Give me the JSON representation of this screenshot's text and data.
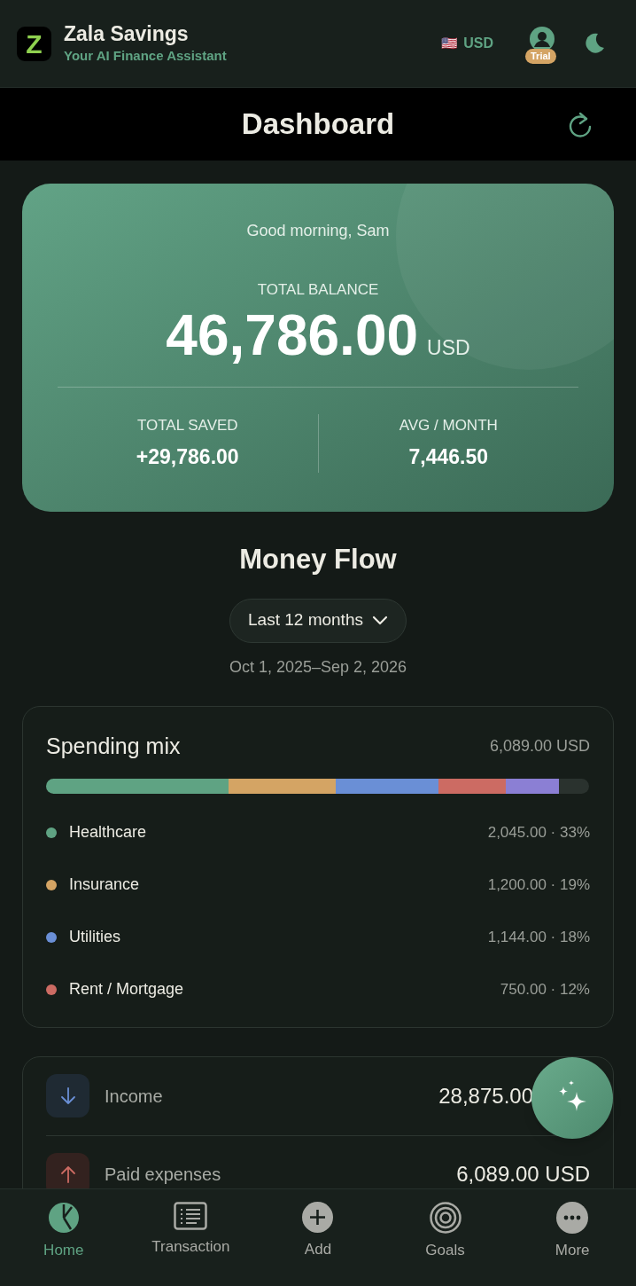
{
  "app": {
    "logo": "Z",
    "name": "Zala Savings",
    "tagline": "Your AI Finance Assistant",
    "currency": "USD",
    "flag": "🇺🇸",
    "badge": "Trial"
  },
  "page_title": "Dashboard",
  "balance_card": {
    "greeting": "Good morning, Sam",
    "label": "TOTAL BALANCE",
    "amount": "46,786.00",
    "currency": "USD",
    "stats": [
      {
        "label": "TOTAL SAVED",
        "value": "+29,786.00"
      },
      {
        "label": "AVG / MONTH",
        "value": "7,446.50"
      }
    ]
  },
  "money_flow": {
    "title": "Money Flow",
    "period": "Last 12 months",
    "range": "Oct 1, 2025–Sep 2, 2026"
  },
  "spending_mix": {
    "title": "Spending mix",
    "total": "6,089.00 USD",
    "bar_segments": [
      {
        "color": "#5fa383"
      },
      {
        "color": "#d4a464"
      },
      {
        "color": "#6a8fd6"
      },
      {
        "color": "#cc6b63"
      },
      {
        "color": "#8b7fd4"
      }
    ],
    "items": [
      {
        "name": "Healthcare",
        "color": "#5fa383",
        "value": "2,045.00 · 33%"
      },
      {
        "name": "Insurance",
        "color": "#d4a464",
        "value": "1,200.00 · 19%"
      },
      {
        "name": "Utilities",
        "color": "#6a8fd6",
        "value": "1,144.00 · 18%"
      },
      {
        "name": "Rent / Mortgage",
        "color": "#cc6b63",
        "value": "750.00 · 12%"
      }
    ]
  },
  "flow_rows": [
    {
      "kind": "income",
      "label": "Income",
      "amount": "28,875.00"
    },
    {
      "kind": "expense",
      "label": "Paid expenses",
      "amount": "6,089.00 USD"
    }
  ],
  "nav": [
    {
      "kind": "home",
      "label": "Home",
      "selected": true
    },
    {
      "kind": "list",
      "label": "Transaction",
      "selected": false
    },
    {
      "kind": "add",
      "label": "Add",
      "selected": false
    },
    {
      "kind": "goals",
      "label": "Goals",
      "selected": false
    },
    {
      "kind": "more",
      "label": "More",
      "selected": false
    }
  ]
}
